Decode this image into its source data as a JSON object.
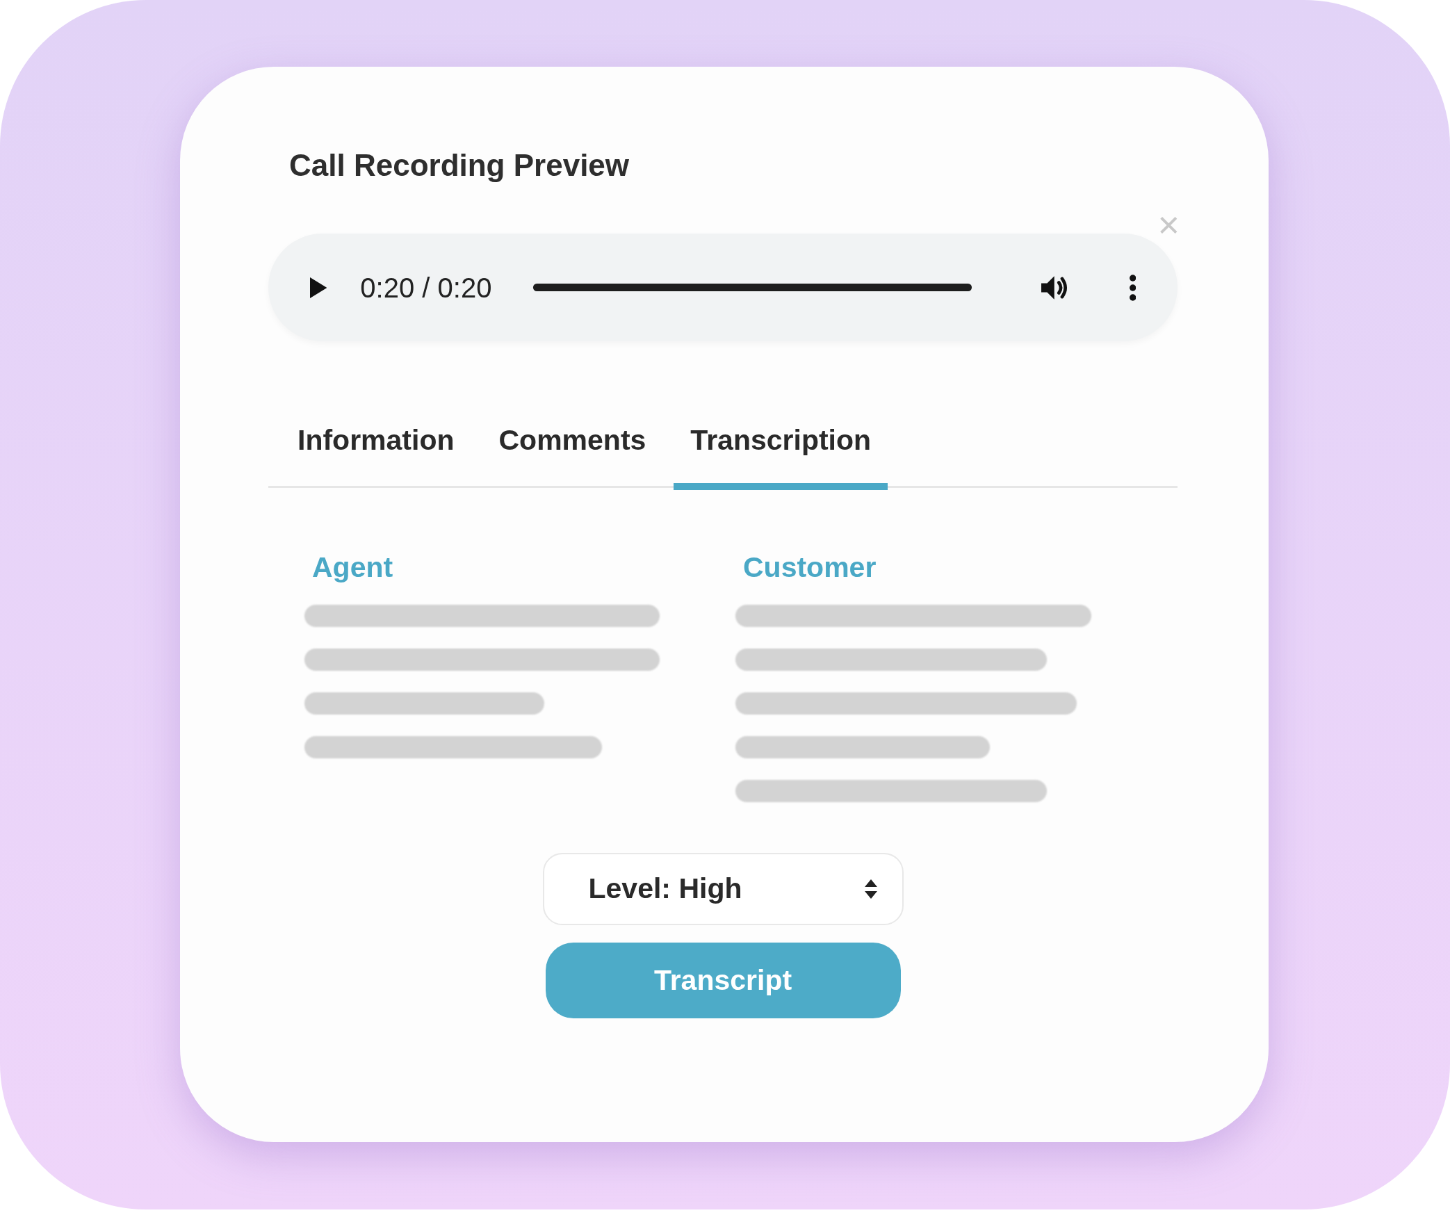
{
  "dialog": {
    "title": "Call Recording Preview",
    "close": "×"
  },
  "player": {
    "time": "0:20 / 0:20",
    "level": 1
  },
  "tabs": [
    {
      "label": "Information",
      "selected": false
    },
    {
      "label": "Comments",
      "selected": false
    },
    {
      "label": "Transcription",
      "selected": true
    }
  ],
  "columns": [
    {
      "heading": "Agent"
    },
    {
      "heading": "Customer"
    }
  ],
  "level_select": {
    "value": "Level: High"
  },
  "button": "Transcript"
}
